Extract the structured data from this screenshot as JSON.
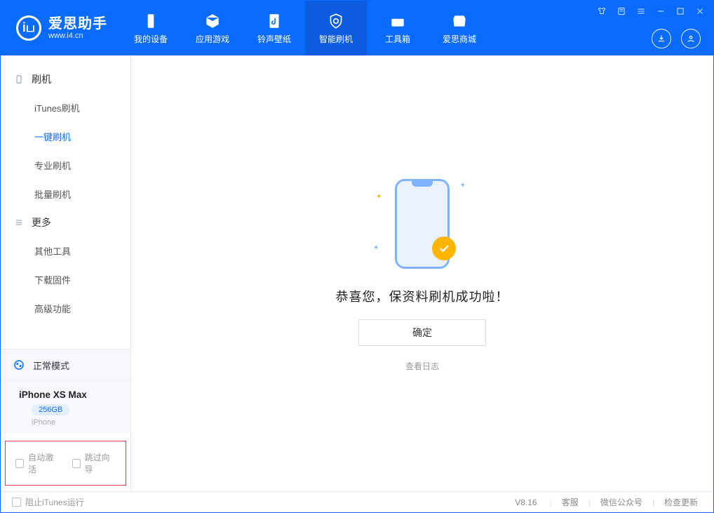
{
  "app": {
    "title": "爱思助手",
    "subtitle": "www.i4.cn",
    "logo_letter": "iப"
  },
  "nav": {
    "items": [
      {
        "label": "我的设备"
      },
      {
        "label": "应用游戏"
      },
      {
        "label": "铃声壁纸"
      },
      {
        "label": "智能刷机"
      },
      {
        "label": "工具箱"
      },
      {
        "label": "爱思商城"
      }
    ]
  },
  "sidebar": {
    "group1": {
      "title": "刷机",
      "items": [
        "iTunes刷机",
        "一键刷机",
        "专业刷机",
        "批量刷机"
      ]
    },
    "group2": {
      "title": "更多",
      "items": [
        "其他工具",
        "下载固件",
        "高级功能"
      ]
    },
    "mode_label": "正常模式",
    "device": {
      "name": "iPhone XS Max",
      "storage": "256GB",
      "type": "iPhone"
    },
    "checks": {
      "auto_activate": "自动激活",
      "skip_guide": "跳过向导"
    }
  },
  "main": {
    "success_text": "恭喜您，保资料刷机成功啦！",
    "ok_button": "确定",
    "log_link": "查看日志"
  },
  "statusbar": {
    "block_itunes": "阻止iTunes运行",
    "version": "V8.16",
    "links": [
      "客服",
      "微信公众号",
      "检查更新"
    ]
  }
}
